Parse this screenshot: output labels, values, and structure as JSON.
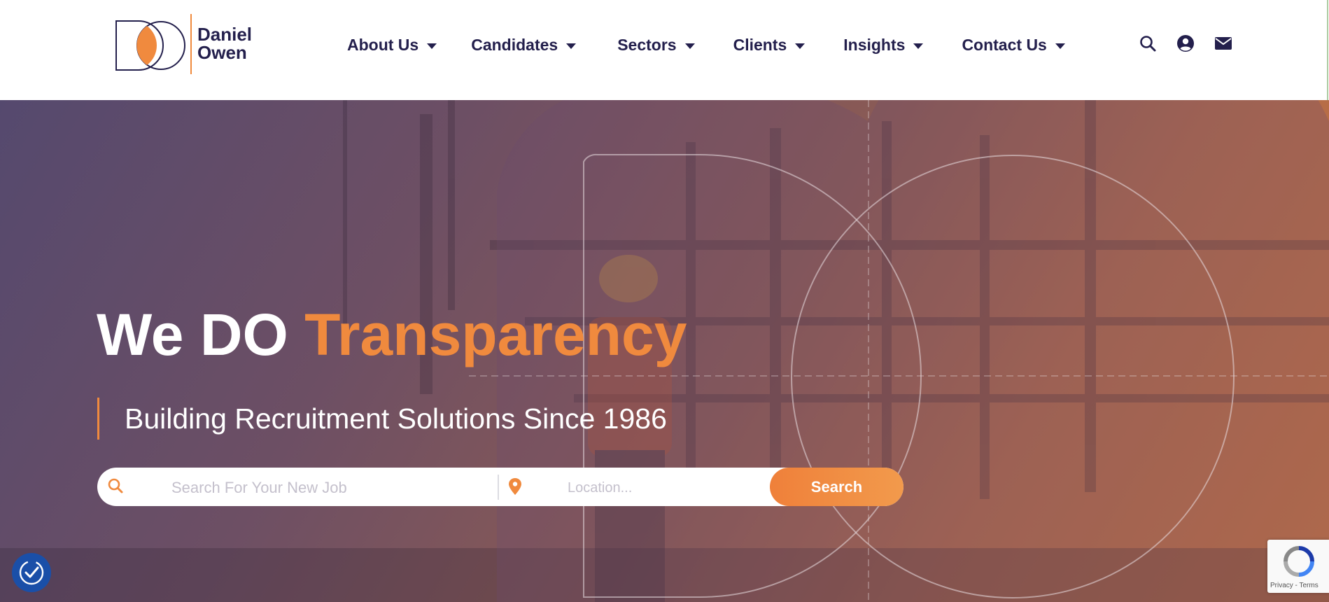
{
  "brand": {
    "line1": "Daniel",
    "line2": "Owen",
    "accent": "#f08a3e",
    "navy": "#231f4c"
  },
  "nav": {
    "items": [
      {
        "label": "About Us"
      },
      {
        "label": "Candidates"
      },
      {
        "label": "Sectors"
      },
      {
        "label": "Clients"
      },
      {
        "label": "Insights"
      },
      {
        "label": "Contact Us"
      }
    ],
    "tools": [
      "search-icon",
      "user-icon",
      "envelope-icon"
    ]
  },
  "hero": {
    "headline_white": "We DO",
    "headline_orange": "Transparency",
    "subtitle": "Building Recruitment Solutions Since 1986",
    "search": {
      "job_placeholder": "Search For Your New Job",
      "location_placeholder": "Location...",
      "button_label": "Search"
    }
  },
  "recaptcha": {
    "text": "Privacy - Terms"
  }
}
